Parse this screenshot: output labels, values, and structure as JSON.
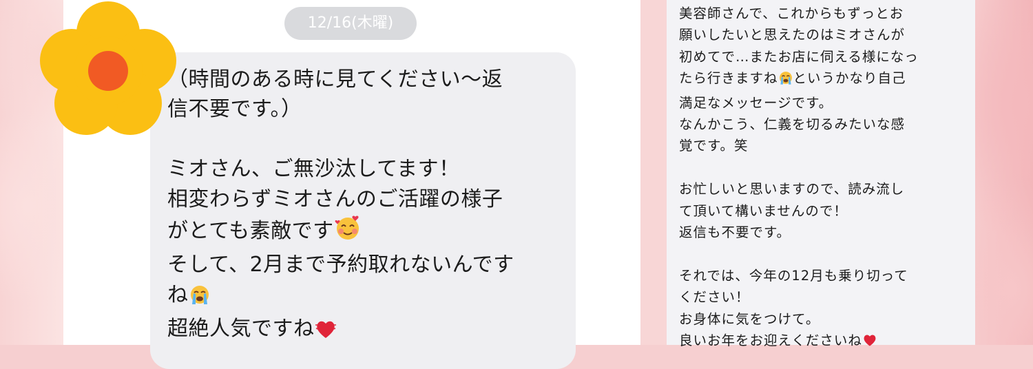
{
  "date_label": "12/16(木曜)",
  "left_message": {
    "line1": "（時間のある時に見てください〜返",
    "line2": "信不要です。）",
    "line3": "",
    "line4": "ミオさん、ご無沙汰してます！",
    "line5": "相変わらずミオさんのご活躍の様子",
    "line6": "がとても素敵です",
    "line7": "そして、2月まで予約取れないんです",
    "line8": "ね",
    "line9": "超絶人気ですね"
  },
  "right_message": {
    "line1": "美容師さんで、これからもずっとお",
    "line2": "願いしたいと思えたのはミオさんが",
    "line3": "初めてで…またお店に伺える様になっ",
    "line4a": "たら行きますね",
    "line4b": "というかなり自己",
    "line5": "満足なメッセージです。",
    "line6": "なんかこう、仁義を切るみたいな感",
    "line7": "覚です。笑",
    "line8": "",
    "line9": "お忙しいと思いますので、読み流し",
    "line10": "て頂いて構いませんので！",
    "line11": "返信も不要です。",
    "line12": "",
    "line13": "それでは、今年の12月も乗り切って",
    "line14": "ください！",
    "line15": "お身体に気をつけて。",
    "line16": "良いお年をお迎えくださいね"
  },
  "icons": {
    "flower": "flower-sticker-icon",
    "smile_hearts": "smiling-face-with-hearts-icon",
    "crying": "loudly-crying-face-icon",
    "heart": "red-heart-icon"
  },
  "colors": {
    "flower_petal": "#fbbf13",
    "flower_center": "#f15a24",
    "bubble": "#efeff2",
    "date_pill": "#d9dadd"
  }
}
